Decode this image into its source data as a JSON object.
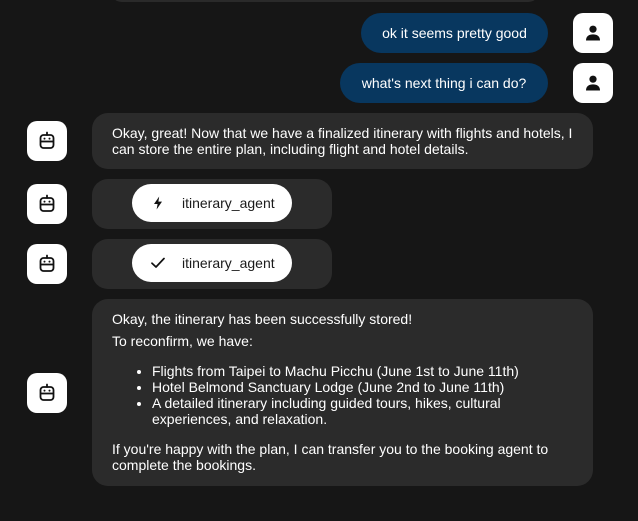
{
  "messages": {
    "user_1": "ok it seems pretty good",
    "user_2": "what's next thing i can do?",
    "bot_1": "Okay, great! Now that we have a finalized itinerary with flights and hotels, I can store the entire plan, including flight and hotel details.",
    "tool_call": {
      "name": "itinerary_agent",
      "icon": "lightning-bolt-icon"
    },
    "tool_result": {
      "name": "itinerary_agent",
      "icon": "checkmark-icon"
    },
    "bot_2": {
      "line_1": "Okay, the itinerary has been successfully stored!",
      "line_2": "To reconfirm, we have:",
      "items": [
        "Flights from Taipei to Machu Picchu (June 1st to June 11th)",
        "Hotel Belmond Sanctuary Lodge (June 2nd to June 11th)",
        "A detailed itinerary including guided tours, hikes, cultural experiences, and relaxation."
      ],
      "closing": "If you're happy with the plan, I can transfer you to the booking agent to complete the bookings."
    }
  },
  "colors": {
    "background": "#161616",
    "user_bubble": "#08375f",
    "bot_bubble": "#2b2b2b",
    "avatar": "#ffffff"
  },
  "icons": {
    "user_avatar": "person-icon",
    "bot_avatar": "robot-icon"
  }
}
